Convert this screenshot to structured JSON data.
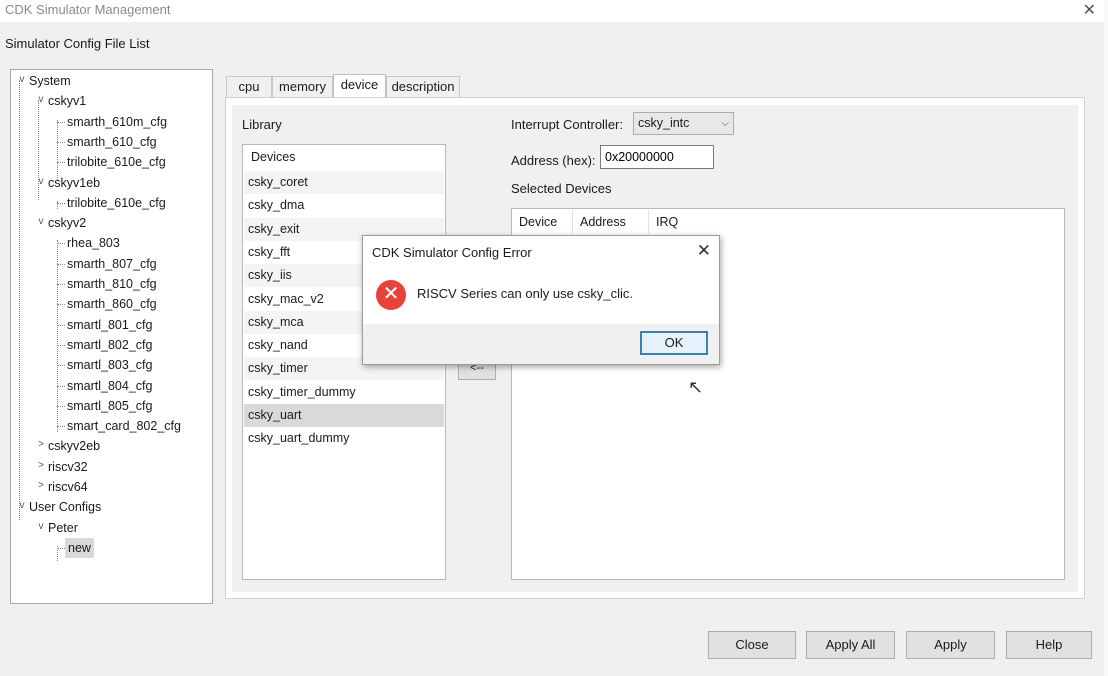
{
  "window": {
    "title": "CDK Simulator Management",
    "close_symbol": "✕"
  },
  "section_label": "Simulator Config File List",
  "tree": {
    "system": "System",
    "ckv1": "cskyv1",
    "ckv1_items": [
      "smarth_610m_cfg",
      "smarth_610_cfg",
      "trilobite_610e_cfg"
    ],
    "ckv1eb": "cskyv1eb",
    "ckv1eb_items": [
      "trilobite_610e_cfg"
    ],
    "ckv2": "cskyv2",
    "ckv2_items": [
      "rhea_803",
      "smarth_807_cfg",
      "smarth_810_cfg",
      "smarth_860_cfg",
      "smartl_801_cfg",
      "smartl_802_cfg",
      "smartl_803_cfg",
      "smartl_804_cfg",
      "smartl_805_cfg",
      "smart_card_802_cfg"
    ],
    "ckv2eb": "cskyv2eb",
    "riscv32": "riscv32",
    "riscv64": "riscv64",
    "user_configs": "User Configs",
    "peter": "Peter",
    "new": "new",
    "expanded": "v",
    "collapsed": ">"
  },
  "tabs": [
    "cpu",
    "memory",
    "device",
    "description"
  ],
  "device": {
    "library_label": "Library",
    "library_header": "Devices",
    "library_items": [
      "csky_coret",
      "csky_dma",
      "csky_exit",
      "csky_fft",
      "csky_iis",
      "csky_mac_v2",
      "csky_mca",
      "csky_nand",
      "csky_timer",
      "csky_timer_dummy",
      "csky_uart",
      "csky_uart_dummy"
    ],
    "selected_index": 10,
    "interrupt_label": "Interrupt Controller:",
    "interrupt_value": "csky_intc",
    "address_label": "Address (hex):",
    "address_value": "0x20000000",
    "selected_label": "Selected Devices",
    "columns": [
      "Device",
      "Address",
      "IRQ"
    ],
    "move_label": "<--"
  },
  "buttons": {
    "close": "Close",
    "apply_all": "Apply All",
    "apply": "Apply",
    "help": "Help"
  },
  "dialog": {
    "title": "CDK Simulator Config Error",
    "close_symbol": "✕",
    "icon": "✕",
    "message": "RISCV Series can only use csky_clic.",
    "ok": "OK"
  }
}
